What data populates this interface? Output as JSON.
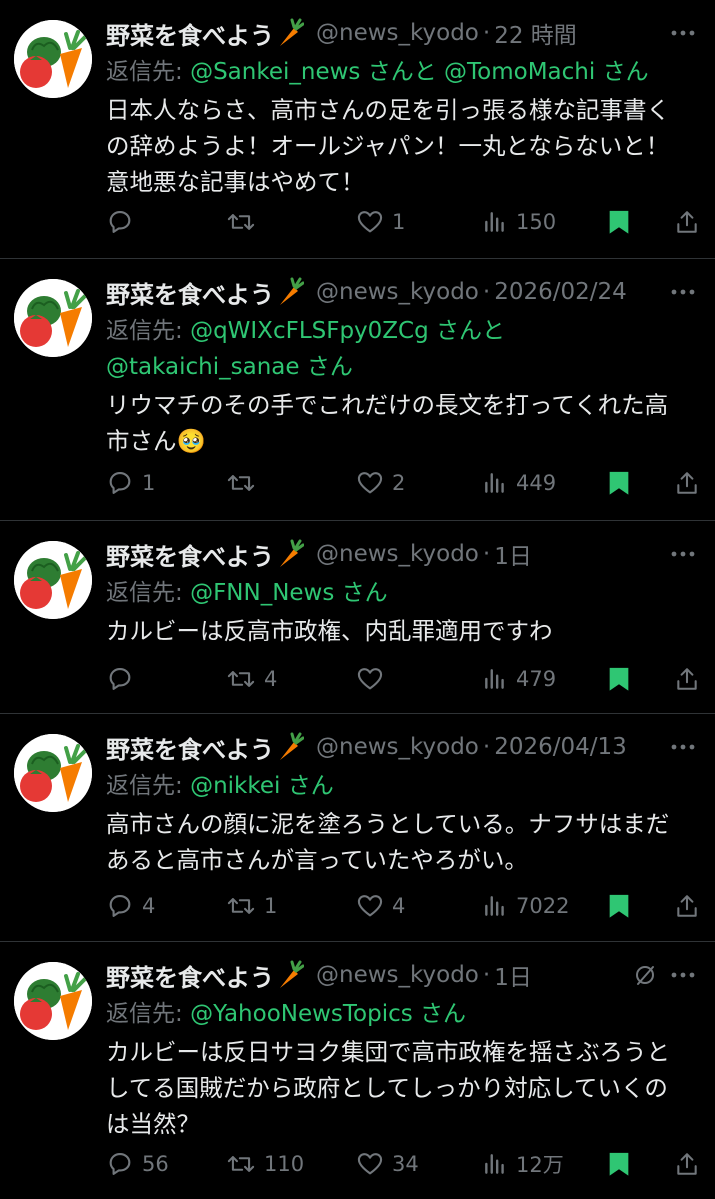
{
  "colors": {
    "background": "#000000",
    "text": "#e7e9ea",
    "muted": "#71767b",
    "accent": "#2fc673",
    "divider": "#2f3336"
  },
  "icons": {
    "reply": "reply-icon",
    "retweet": "retweet-icon",
    "like": "heart-icon",
    "views": "views-icon",
    "bookmark": "bookmark-icon",
    "share": "share-icon",
    "more": "more-icon",
    "grok": "grok-icon",
    "carrot": "carrot-emoji"
  },
  "tweets": [
    {
      "name": "野菜を食べよう",
      "handle": "@news_kyodo",
      "sep": "·",
      "time": "22 時間",
      "reply_prefix": "返信先: ",
      "reply_line1": "@Sankei_news さんと @TomoMachi さん",
      "reply_line2": "",
      "text_line1": "日本人ならさ、高市さんの足を引っ張る様な記事書く",
      "text_line2": "の辞めようよ！オールジャパン！一丸とならないと！",
      "text_line3": "意地悪な記事はやめて！",
      "replies": "",
      "retweets": "",
      "likes": "1",
      "views": "150"
    },
    {
      "name": "野菜を食べよう",
      "handle": "@news_kyodo",
      "sep": "·",
      "time": "2026/02/24",
      "reply_prefix": "返信先: ",
      "reply_line1": "@qWIXcFLSFpy0ZCg さんと",
      "reply_line2": "@takaichi_sanae さん",
      "text_line1": "リウマチのその手でこれだけの長文を打ってくれた高",
      "text_line2": "市さん🥹",
      "text_line3": "",
      "replies": "1",
      "retweets": "",
      "likes": "2",
      "views": "449"
    },
    {
      "name": "野菜を食べよう",
      "handle": "@news_kyodo",
      "sep": "·",
      "time": "1日",
      "reply_prefix": "返信先: ",
      "reply_line1": "@FNN_News さん",
      "reply_line2": "",
      "text_line1": "カルビーは反高市政権、内乱罪適用ですわ",
      "text_line2": "",
      "text_line3": "",
      "replies": "",
      "retweets": "4",
      "likes": "",
      "views": "479"
    },
    {
      "name": "野菜を食べよう",
      "handle": "@news_kyodo",
      "sep": "·",
      "time": "2026/04/13",
      "reply_prefix": "返信先: ",
      "reply_line1": "@nikkei さん",
      "reply_line2": "",
      "text_line1": "高市さんの顔に泥を塗ろうとしている。ナフサはまだ",
      "text_line2": "あると高市さんが言っていたやろがい。",
      "text_line3": "",
      "replies": "4",
      "retweets": "1",
      "likes": "4",
      "views": "7022"
    },
    {
      "name": "野菜を食べよう",
      "handle": "@news_kyodo",
      "sep": "·",
      "time": "1日",
      "reply_prefix": "返信先: ",
      "reply_line1": "@YahooNewsTopics さん",
      "reply_line2": "",
      "text_line1": "カルビーは反日サヨク集団で高市政権を揺さぶろうと",
      "text_line2": "してる国賊だから政府としてしっかり対応していくの",
      "text_line3": "は当然？",
      "replies": "56",
      "retweets": "110",
      "likes": "34",
      "views": "12万"
    }
  ]
}
